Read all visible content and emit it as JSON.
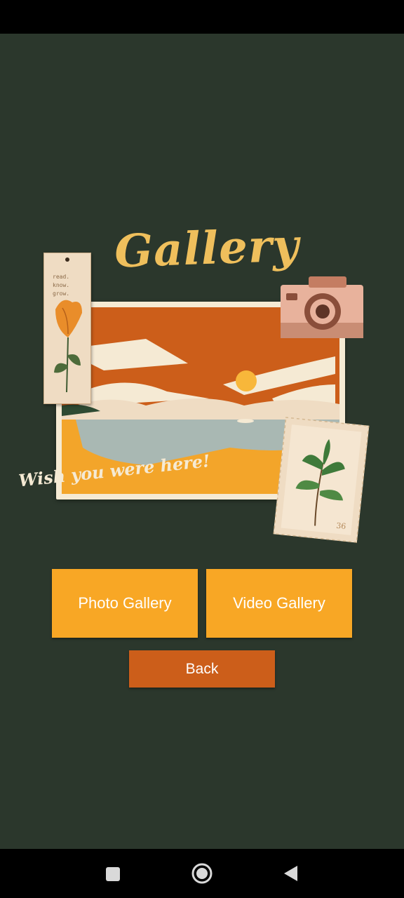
{
  "screen": {
    "title": "Gallery",
    "postcard_caption": "Wish you were here!",
    "bookmark_text": "read.\nknow.\ngrow.",
    "stamp_number": "36"
  },
  "buttons": {
    "photo_gallery": "Photo Gallery",
    "video_gallery": "Video Gallery",
    "back": "Back"
  },
  "icons": {
    "nav_recents": "square-icon",
    "nav_home": "circle-home-icon",
    "nav_back": "triangle-back-icon"
  },
  "colors": {
    "background": "#2b372c",
    "accent": "#f8a725",
    "back_button": "#cc5e1a",
    "title": "#efbf5c"
  }
}
